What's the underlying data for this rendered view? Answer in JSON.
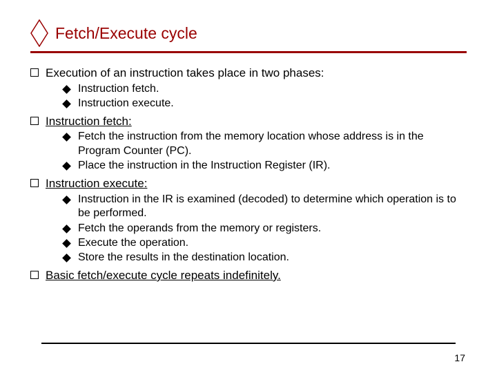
{
  "title": "Fetch/Execute cycle",
  "b1": {
    "text": "Execution of an instruction takes place in two phases:"
  },
  "b1s": {
    "a": "Instruction fetch.",
    "b": "Instruction execute."
  },
  "b2": {
    "text": "Instruction fetch:"
  },
  "b2s": {
    "a": "Fetch the instruction from the memory location whose address is in the Program Counter (PC).",
    "b": "Place the instruction in the Instruction Register (IR)."
  },
  "b3": {
    "text": "Instruction execute:"
  },
  "b3s": {
    "a": "Instruction in the IR is examined (decoded) to determine which operation is to be performed.",
    "b": "Fetch the operands from the memory or registers.",
    "c": "Execute the operation.",
    "d": "Store the results in the destination location."
  },
  "b4": {
    "text": "Basic fetch/execute cycle repeats indefinitely."
  },
  "page": "17"
}
